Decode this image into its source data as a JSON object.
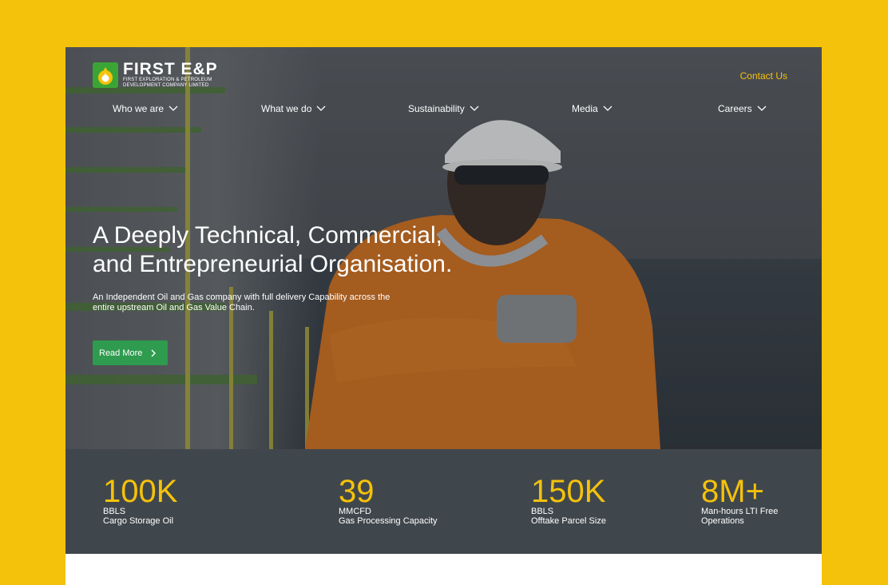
{
  "brand": {
    "name": "FIRST E&P",
    "subline1": "FIRST EXPLORATION & PETROLEUM",
    "subline2": "DEVELOPMENT COMPANY LIMITED",
    "accent": "#F5C20B",
    "green": "#2E9B4E"
  },
  "header": {
    "contact_label": "Contact Us"
  },
  "nav": {
    "items": [
      {
        "label": "Who we are"
      },
      {
        "label": "What we do"
      },
      {
        "label": "Sustainability"
      },
      {
        "label": "Media"
      },
      {
        "label": "Careers"
      }
    ]
  },
  "hero": {
    "headline_line1": "A Deeply Technical, Commercial,",
    "headline_line2": "and Entrepreneurial Organisation.",
    "subtext_line1": "An Independent Oil and Gas company with full delivery Capability across the",
    "subtext_line2": "entire upstream Oil and Gas Value Chain.",
    "cta_label": "Read More",
    "cta_icon": "chevron-right-icon"
  },
  "stats": [
    {
      "value": "100K",
      "unit": "BBLS",
      "label": "Cargo Storage Oil"
    },
    {
      "value": "39",
      "unit": "MMCFD",
      "label": "Gas Processing Capacity"
    },
    {
      "value": "150K",
      "unit": "BBLS",
      "label": "Offtake Parcel Size"
    },
    {
      "value": "8M+",
      "unit": "Man-hours LTI Free",
      "label": "Operations"
    }
  ]
}
